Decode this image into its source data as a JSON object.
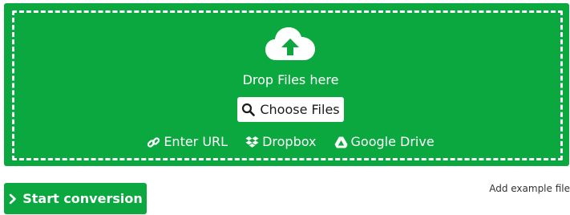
{
  "upload": {
    "title": "Drop Files here",
    "choose_label": "Choose Files",
    "sources": [
      {
        "label": "Enter URL",
        "icon": "link-icon"
      },
      {
        "label": "Dropbox",
        "icon": "dropbox-icon"
      },
      {
        "label": "Google Drive",
        "icon": "google-drive-icon"
      }
    ]
  },
  "actions": {
    "start_label": "Start conversion",
    "example_label": "Add example file"
  },
  "colors": {
    "accent": "#0aa83f",
    "text_on_accent": "#ffffff"
  }
}
